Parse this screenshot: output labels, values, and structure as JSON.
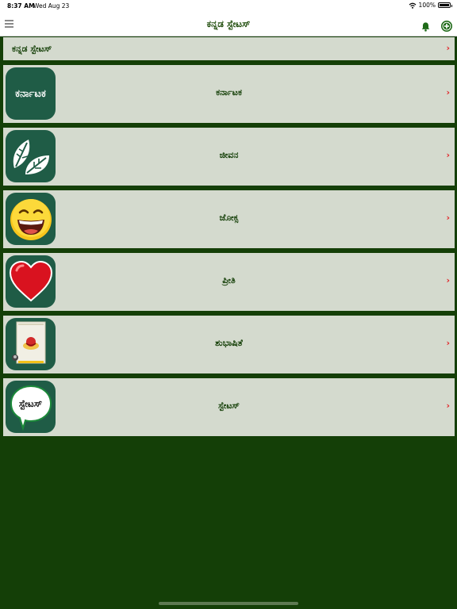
{
  "status": {
    "time": "8:37 AM",
    "date": "Wed Aug 23",
    "battery": "100%"
  },
  "nav": {
    "title": "ಕನ್ನಡ ಸ್ಟೇಟಸ್"
  },
  "header": {
    "label": "ಕನ್ನಡ ಸ್ಟೇಟಸ್",
    "chevron": "›"
  },
  "categories": [
    {
      "label": "ಕರ್ನಾಟಕ",
      "thumb_text": "ಕರ್ನಾಟಕ",
      "chevron": "›"
    },
    {
      "label": "ಜೀವನ",
      "thumb_icon": "leaves-icon",
      "chevron": "›"
    },
    {
      "label": "ಜೋಕ್ಸ",
      "thumb_icon": "laughing-face-icon",
      "chevron": "›"
    },
    {
      "label": "ಪ್ರೀತಿ",
      "thumb_icon": "heart-icon",
      "chevron": "›"
    },
    {
      "label": "ಶುಭಾಷಿತೆ",
      "thumb_icon": "scroll-icon",
      "chevron": "›"
    },
    {
      "label": "ಸ್ಟೇಟಸ್",
      "thumb_text": "ಸ್ಟೇಟಸ್",
      "chevron": "›"
    }
  ],
  "colors": {
    "accent": "#e3262a",
    "background": "#143f07",
    "row": "#d4dace",
    "thumb": "#1f5c46"
  }
}
